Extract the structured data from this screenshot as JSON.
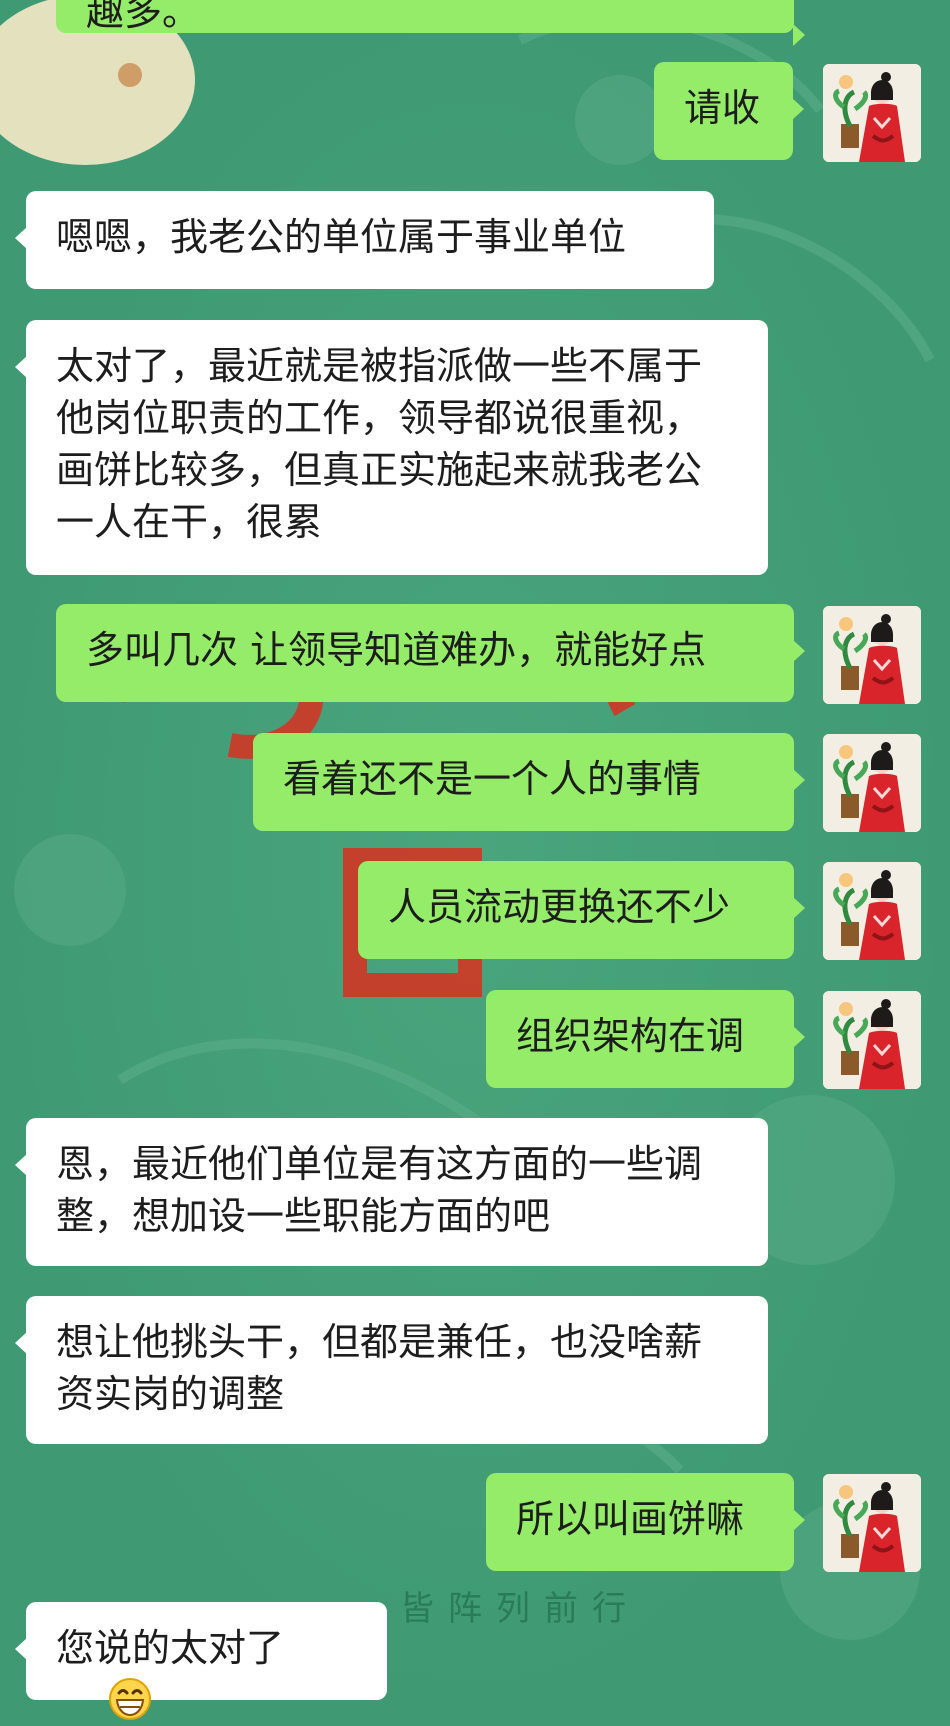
{
  "chat": {
    "messages": [
      {
        "side": "out",
        "text": "趣多。"
      },
      {
        "side": "out",
        "text": "请收"
      },
      {
        "side": "in",
        "text": "嗯嗯，我老公的单位属于事业单位"
      },
      {
        "side": "in",
        "text": "太对了，最近就是被指派做一些不属于他岗位职责的工作，领导都说很重视，画饼比较多，但真正实施起来就我老公一人在干，很累"
      },
      {
        "side": "out",
        "text": "多叫几次 让领导知道难办，就能好点"
      },
      {
        "side": "out",
        "text": "看着还不是一个人的事情"
      },
      {
        "side": "out",
        "text": "人员流动更换还不少"
      },
      {
        "side": "out",
        "text": "组织架构在调"
      },
      {
        "side": "in",
        "text": "恩，最近他们单位是有这方面的一些调整，想加设一些职能方面的吧"
      },
      {
        "side": "in",
        "text": "想让他挑头干，但都是兼任，也没啥薪资实岗的调整"
      },
      {
        "side": "out",
        "text": "所以叫画饼嘛"
      },
      {
        "side": "in",
        "text": "您说的太对了",
        "emoji": "grinning-face-icon"
      }
    ]
  },
  "background": {
    "watermark_text": "皆阵列前行"
  },
  "colors": {
    "background": "#3f9a74",
    "outgoing_bubble": "#95ec69",
    "incoming_bubble": "#ffffff",
    "text": "#1d1d1d",
    "avatar_robe": "#d8242a"
  },
  "icons": {
    "avatar": "woman-in-red-hanfu-avatar-icon",
    "emoji": "grinning-face-icon"
  }
}
